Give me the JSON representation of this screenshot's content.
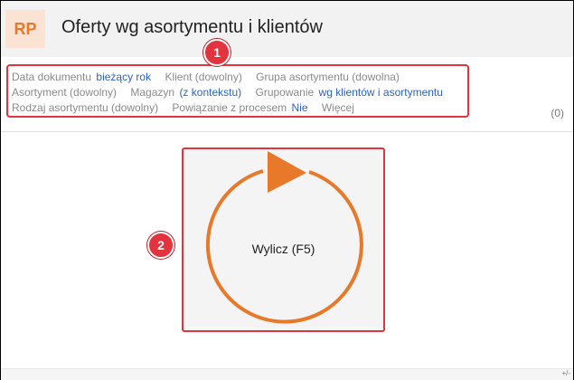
{
  "header": {
    "logo": "RP",
    "title": "Oferty wg asortymentu i klientów"
  },
  "filters": {
    "row1": [
      {
        "label": "Data dokumentu",
        "value": "bieżący rok"
      },
      {
        "label": "Klient (dowolny)",
        "value": ""
      },
      {
        "label": "Grupa asortymentu (dowolna)",
        "value": ""
      }
    ],
    "row2": [
      {
        "label": "Asortyment (dowolny)",
        "value": ""
      },
      {
        "label": "Magazyn",
        "value": "(z kontekstu)"
      },
      {
        "label": "Grupowanie",
        "value": "wg klientów i asortymentu"
      }
    ],
    "row3": [
      {
        "label": "Rodzaj asortymentu (dowolny)",
        "value": ""
      },
      {
        "label": "Powiązanie z procesem",
        "value": "Nie"
      },
      {
        "label": "Więcej",
        "value": ""
      }
    ]
  },
  "count": "(0)",
  "badges": {
    "one": "1",
    "two": "2"
  },
  "calculate": {
    "label": "Wylicz (F5)"
  },
  "footer": {
    "resize": "+/-"
  },
  "colors": {
    "accent": "#e8782a",
    "highlight": "#e2333f",
    "link": "#2b62c7"
  }
}
